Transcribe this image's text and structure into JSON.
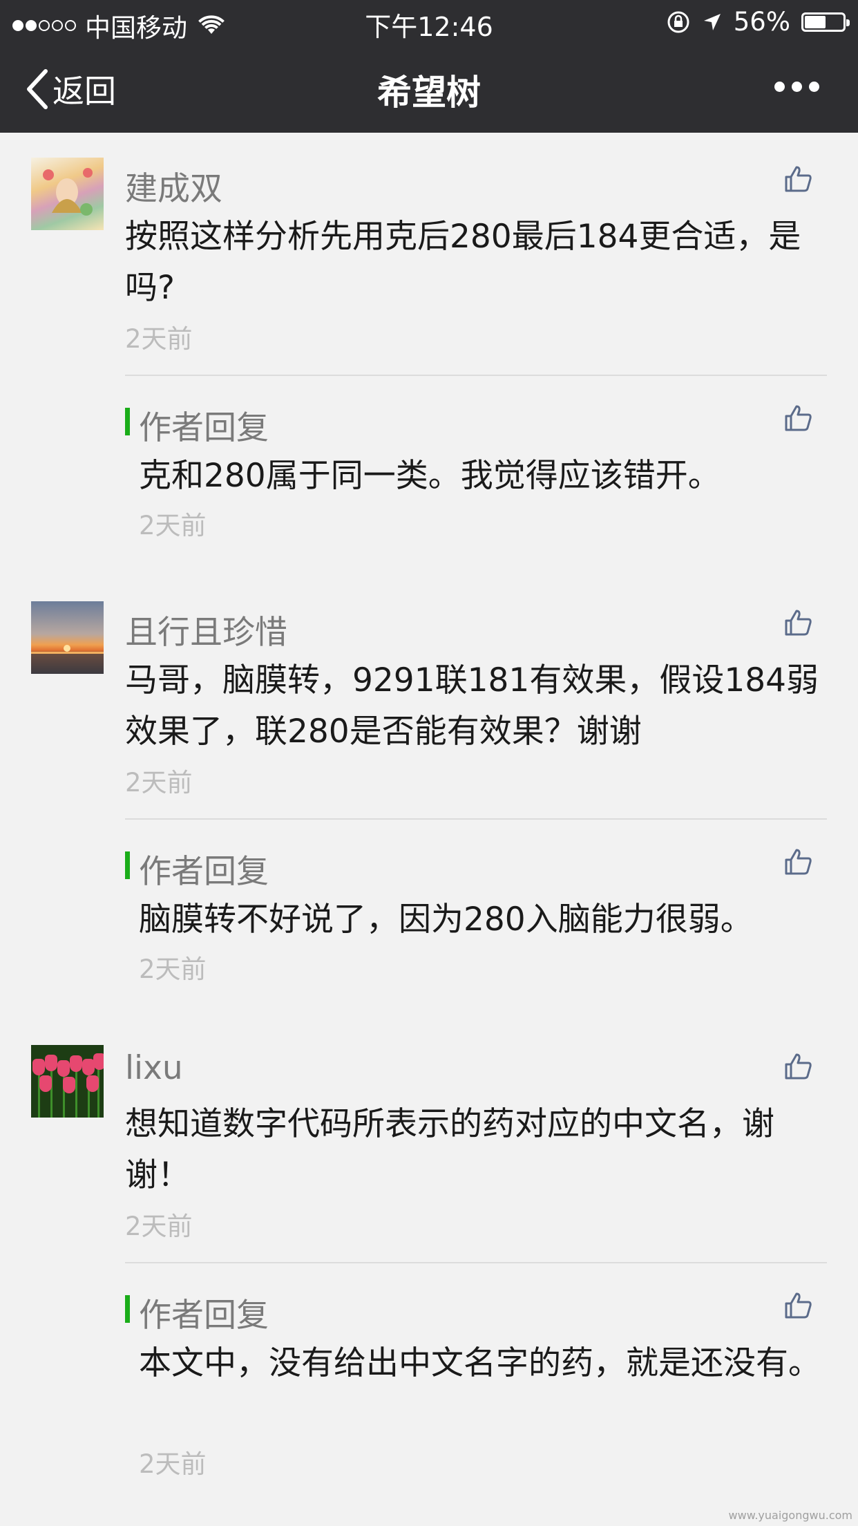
{
  "status_bar": {
    "carrier": "中国移动",
    "time": "下午12:46",
    "battery_percent_text": "56%",
    "battery_level": 0.56,
    "icons": [
      "signal-dots",
      "wifi-icon",
      "rotation-lock-icon",
      "location-arrow-icon",
      "battery-icon"
    ]
  },
  "nav": {
    "back_label": "返回",
    "title": "希望树",
    "more_icon": "more-dots-icon"
  },
  "threads": [
    {
      "username": "建成双",
      "text": "按照这样分析先用克后280最后184更合适，是吗?",
      "time": "2天前",
      "reply": {
        "label": "作者回复",
        "text": "克和280属于同一类。我觉得应该错开。",
        "time": "2天前"
      }
    },
    {
      "username": "且行且珍惜",
      "text": "马哥，脑膜转，9291联181有效果，假设184弱效果了，联280是否能有效果？谢谢",
      "time": "2天前",
      "reply": {
        "label": "作者回复",
        "text": "脑膜转不好说了，因为280入脑能力很弱。",
        "time": "2天前"
      }
    },
    {
      "username": "lixu",
      "text": "想知道数字代码所表示的药对应的中文名，谢谢！",
      "time": "2天前",
      "reply": {
        "label": "作者回复",
        "text": "本文中，没有给出中文名字的药，就是还没有。",
        "time": "2天前"
      }
    }
  ],
  "watermark": "www.yuaigongwu.com",
  "colors": {
    "nav_bg": "#2e2e31",
    "page_bg": "#f2f2f2",
    "reply_accent": "#1aad19",
    "like_icon": "#5b6b8a"
  }
}
